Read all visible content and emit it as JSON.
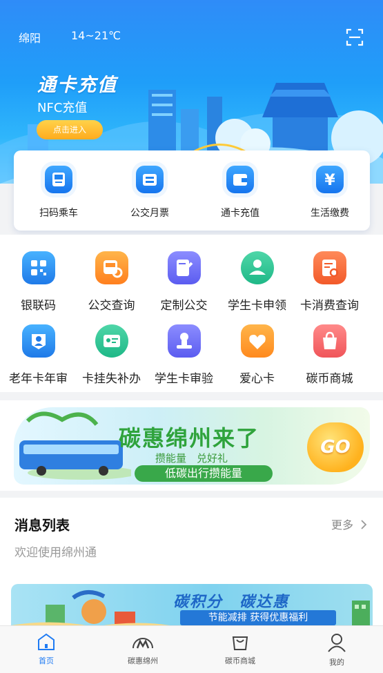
{
  "status": {
    "city": "绵阳",
    "weather": "14~21℃"
  },
  "hero": {
    "title": "通卡充值",
    "subtitle": "NFC充值",
    "cta": "点击进入"
  },
  "quick_actions": [
    {
      "label": "扫码乘车",
      "icon": "qr-bus-icon"
    },
    {
      "label": "公交月票",
      "icon": "monthly-ticket-icon"
    },
    {
      "label": "通卡充值",
      "icon": "wallet-icon"
    },
    {
      "label": "生活缴费",
      "icon": "yen-icon"
    }
  ],
  "services": [
    {
      "label": "银联码",
      "icon": "unionpay-code-icon"
    },
    {
      "label": "公交查询",
      "icon": "bus-search-icon"
    },
    {
      "label": "定制公交",
      "icon": "custom-bus-icon"
    },
    {
      "label": "学生卡申领",
      "icon": "student-card-icon"
    },
    {
      "label": "卡消费查询",
      "icon": "card-consumption-icon"
    },
    {
      "label": "老年卡年审",
      "icon": "senior-card-icon"
    },
    {
      "label": "卡挂失补办",
      "icon": "card-loss-icon"
    },
    {
      "label": "学生卡审验",
      "icon": "student-verify-icon"
    },
    {
      "label": "爱心卡",
      "icon": "love-card-icon"
    },
    {
      "label": "碳币商城",
      "icon": "carbon-mall-icon"
    }
  ],
  "banner": {
    "title": "碳惠绵州来了",
    "subtitle": "攒能量　兑好礼",
    "pill": "低碳出行攒能量",
    "go": "GO"
  },
  "messages": {
    "title": "消息列表",
    "more": "更多",
    "text": "欢迎使用绵州通"
  },
  "promo": {
    "title": "碳积分　碳达惠",
    "subtitle": "节能减排 获得优惠福利"
  },
  "tabs": [
    {
      "label": "首页",
      "icon": "home-icon",
      "active": true
    },
    {
      "label": "碳惠绵州",
      "icon": "carbon-m-icon",
      "active": false
    },
    {
      "label": "碳币商城",
      "icon": "shopping-bag-icon",
      "active": false
    },
    {
      "label": "我的",
      "icon": "user-icon",
      "active": false
    }
  ],
  "colors": {
    "primary": "#1f7bf3",
    "hero_top": "#2f8cf8",
    "green": "#39a84a",
    "orange": "#ffab1e"
  }
}
